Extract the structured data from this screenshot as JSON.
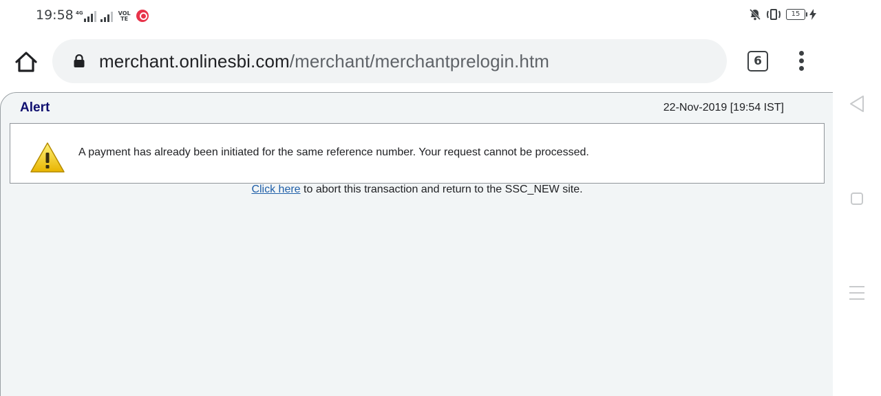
{
  "status_bar": {
    "time": "19:58",
    "network_label": "4G",
    "volte_label": "VOLTE",
    "battery_level": "15",
    "icons": [
      "signal-icon",
      "volte-icon",
      "app-notification-icon",
      "mute-icon",
      "vibrate-icon",
      "battery-icon",
      "charging-icon"
    ]
  },
  "toolbar": {
    "url_domain": "merchant.onlinesbi.com",
    "url_path": "/merchant/merchantprelogin.htm",
    "tab_count": "6",
    "icons": [
      "home-icon",
      "lock-icon",
      "more-vert-icon"
    ]
  },
  "page": {
    "alert_title": "Alert",
    "timestamp": "22-Nov-2019 [19:54 IST]",
    "message": "A payment has already been initiated for the same reference number. Your request cannot be processed.",
    "abort_link": "Click here",
    "abort_text": " to abort this transaction and return to the SSC_NEW site.",
    "icons": [
      "warning-icon"
    ]
  },
  "nav_bar": {
    "icons": [
      "back-icon",
      "home-square-icon",
      "recents-icon"
    ]
  },
  "colors": {
    "alert_title": "#101070",
    "link": "#1f5fa8",
    "page_background": "#f2f5f6",
    "warning_yellow": "#f2c200",
    "notification_red": "#e8334a"
  }
}
